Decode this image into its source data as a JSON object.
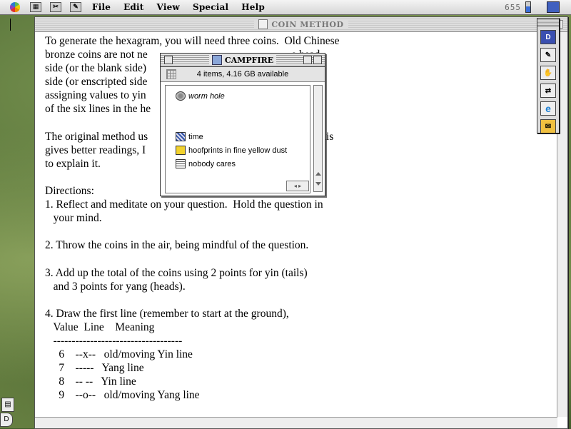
{
  "menubar": {
    "items": [
      "File",
      "Edit",
      "View",
      "Special",
      "Help"
    ],
    "clock": "655"
  },
  "document_window": {
    "title": "COIN METHOD",
    "body": "To generate the hexagram, you will need three coins.  Old Chinese\nbronze coins are not ne                                                    e head\nside (or the blank side)\nside (or enscripted side                                                  d by\nassigning values to yin                                                   ), each\nof the six lines in the he\n\nThe original method us                                                    y say this\ngives better readings, I                                                 are try\nto explain it.\n\nDirections:\n1. Reflect and meditate on your question.  Hold the question in\n   your mind.\n\n2. Throw the coins in the air, being mindful of the question.\n\n3. Add up the total of the coins using 2 points for yin (tails)\n   and 3 points for yang (heads).\n\n4. Draw the first line (remember to start at the ground),\n   Value  Line    Meaning\n   -----------------------------------\n     6    --x--   old/moving Yin line\n     7    -----   Yang line\n     8    -- --   Yin line\n     9    --o--   old/moving Yang line"
  },
  "campfire_window": {
    "title": "CAMPFIRE",
    "info": "4 items, 4.16 GB available",
    "files": [
      {
        "name": "worm hole",
        "icon": "worm-hole-icon"
      },
      {
        "name": "time",
        "icon": "document-icon"
      },
      {
        "name": "hoofprints in fine yellow dust",
        "icon": "yellow-document-icon"
      },
      {
        "name": "nobody cares",
        "icon": "text-document-icon"
      }
    ]
  },
  "palette": {
    "buttons": [
      "D",
      "✎",
      "✋",
      "⇄",
      "e",
      "✉"
    ]
  }
}
